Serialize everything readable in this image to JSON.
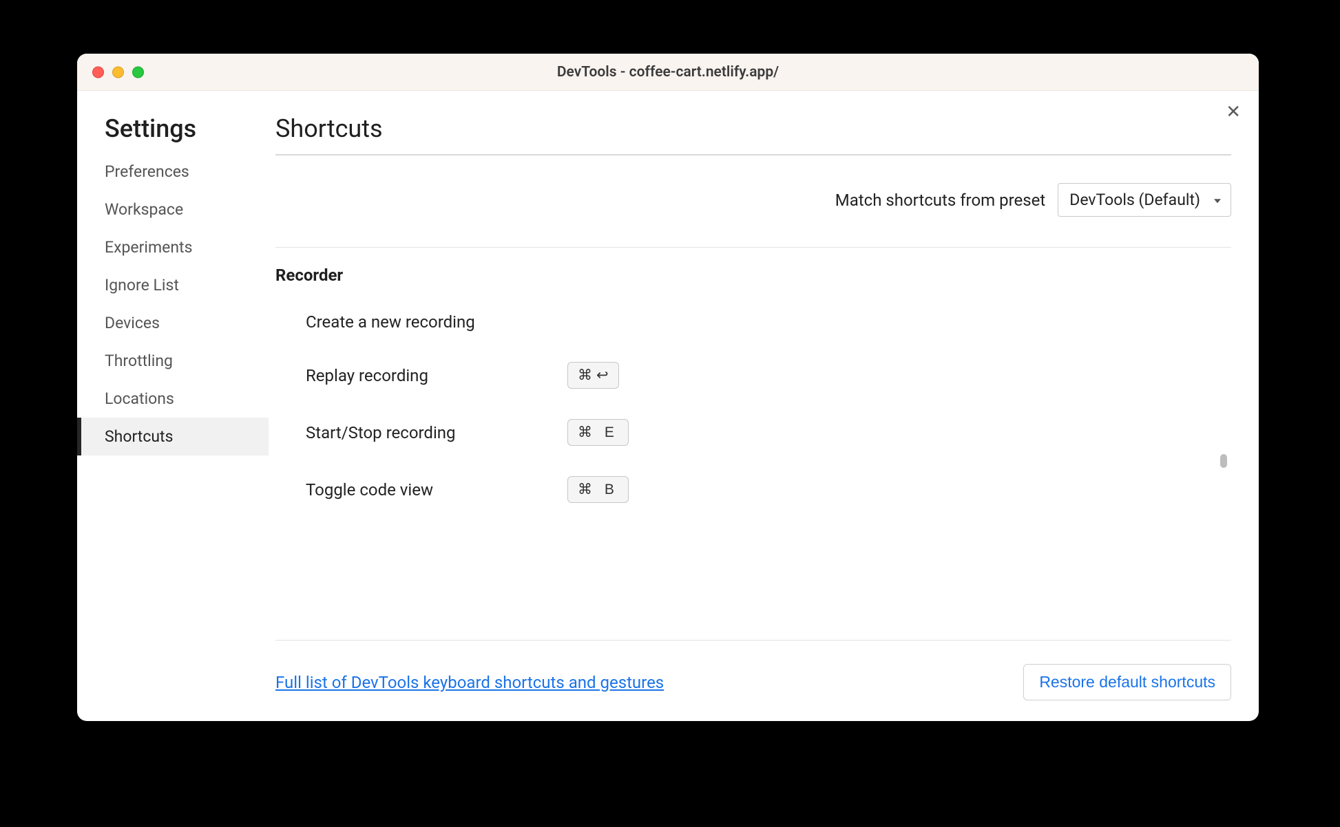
{
  "window": {
    "title": "DevTools - coffee-cart.netlify.app/"
  },
  "sidebar": {
    "title": "Settings",
    "items": [
      {
        "label": "Preferences",
        "active": false
      },
      {
        "label": "Workspace",
        "active": false
      },
      {
        "label": "Experiments",
        "active": false
      },
      {
        "label": "Ignore List",
        "active": false
      },
      {
        "label": "Devices",
        "active": false
      },
      {
        "label": "Throttling",
        "active": false
      },
      {
        "label": "Locations",
        "active": false
      },
      {
        "label": "Shortcuts",
        "active": true
      }
    ]
  },
  "main": {
    "title": "Shortcuts",
    "preset_label": "Match shortcuts from preset",
    "preset_value": "DevTools (Default)",
    "section": {
      "title": "Recorder",
      "rows": [
        {
          "label": "Create a new recording",
          "key": ""
        },
        {
          "label": "Replay recording",
          "key": "⌘ ↵"
        },
        {
          "label": "Start/Stop recording",
          "key": "⌘ E"
        },
        {
          "label": "Toggle code view",
          "key": "⌘ B"
        }
      ]
    },
    "footer_link": "Full list of DevTools keyboard shortcuts and gestures",
    "footer_button": "Restore default shortcuts"
  }
}
